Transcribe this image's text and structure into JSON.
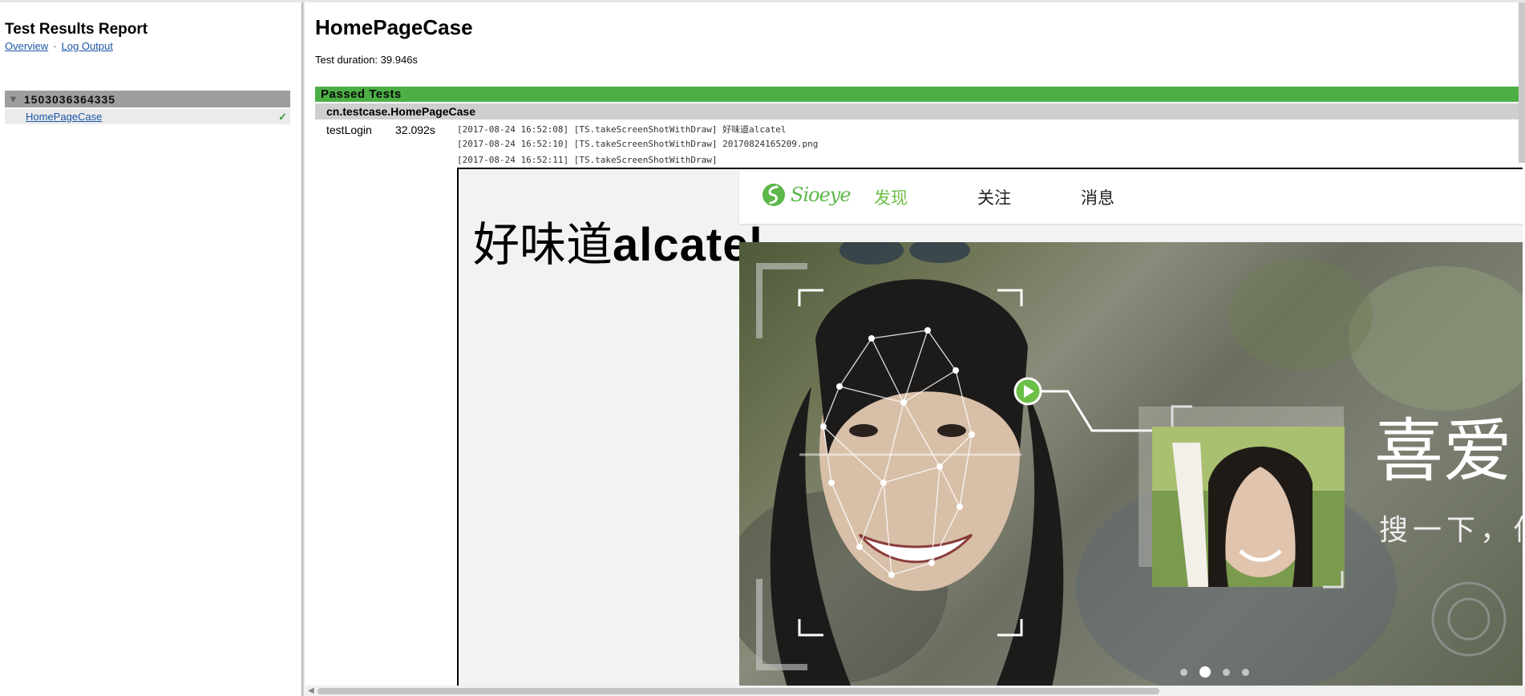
{
  "nav": {
    "title": "Test Results Report",
    "links": {
      "overview": "Overview",
      "separator": "·",
      "log_output": "Log Output"
    },
    "suite": {
      "name": "1503036364335",
      "expander_icon": "triangle-down"
    },
    "cases": [
      {
        "name": "HomePageCase",
        "status_icon": "checkmark"
      }
    ]
  },
  "main": {
    "case_title": "HomePageCase",
    "duration": "Test duration: 39.946s",
    "section_header": "Passed Tests",
    "class_name": "cn.testcase.HomePageCase",
    "method": {
      "name": "testLogin",
      "time": "32.092s"
    },
    "log_lines": [
      "[2017-08-24 16:52:08] [TS.takeScreenShotWithDraw] 好味道alcatel",
      "[2017-08-24 16:52:10] [TS.takeScreenShotWithDraw] 20170824165209.png",
      "[2017-08-24 16:52:11] [TS.takeScreenShotWithDraw]"
    ]
  },
  "screenshot": {
    "drawn_text_cn": "好味道",
    "drawn_text_en": "alcatel",
    "app": {
      "logo_text": "Sioeye",
      "tabs": [
        {
          "label": "发现",
          "active": true
        },
        {
          "label": "关注",
          "active": false
        },
        {
          "label": "消息",
          "active": false
        }
      ],
      "banner_title": "喜爱",
      "banner_subtitle": "搜一下，你",
      "carousel_dots": 4,
      "carousel_active_index": 1
    }
  },
  "colors": {
    "passed_green": "#4caf45",
    "class_header_gray": "#cfcfcf",
    "suite_row_gray": "#9e9e9e",
    "link_blue": "#1a56a6",
    "app_accent_green": "#6bbf47"
  }
}
